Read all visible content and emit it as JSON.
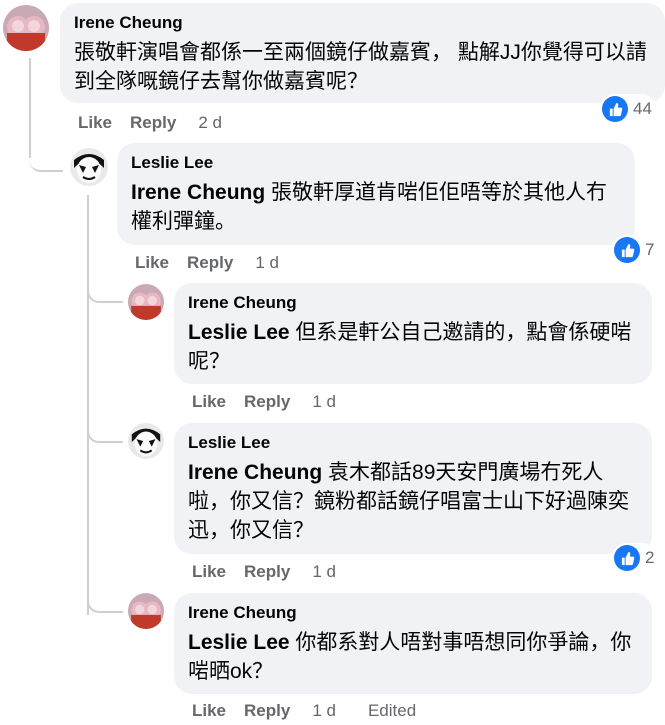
{
  "actions": {
    "like": "Like",
    "reply": "Reply"
  },
  "comments": [
    {
      "author": "Irene Cheung",
      "mention": "",
      "text": "張敬軒演唱會都係一至兩個鏡仔做嘉賓， 點解JJ你覺得可以請到全隊嘅鏡仔去幫你做嘉賓呢？",
      "time": "2 d",
      "reactions": "44",
      "edited": ""
    },
    {
      "author": "Leslie Lee",
      "mention": "Irene Cheung",
      "text": " 張敬軒厚道肯啱佢佢唔等於其他人冇權利彈鐘。",
      "time": "1 d",
      "reactions": "7",
      "edited": ""
    },
    {
      "author": "Irene Cheung",
      "mention": "Leslie Lee",
      "text": " 但系是軒公自己邀請的，點會係硬啱呢？",
      "time": "1 d",
      "reactions": "",
      "edited": ""
    },
    {
      "author": "Leslie Lee",
      "mention": "Irene Cheung",
      "text": " 袁木都話89天安門廣場冇死人啦，你又信？鏡粉都話鏡仔唱富士山下好過陳奕迅，你又信？",
      "time": "1 d",
      "reactions": "2",
      "edited": ""
    },
    {
      "author": "Irene Cheung",
      "mention": "Leslie Lee",
      "text": " 你都系對人唔對事唔想同你爭論，你啱晒ok？",
      "time": "1 d",
      "reactions": "",
      "edited": "Edited"
    }
  ],
  "colors": {
    "bubble": "#f0f2f5",
    "like_blue": "#1877f2",
    "meta_gray": "#65676b"
  },
  "icons": {
    "reaction": "like-thumb-icon"
  }
}
